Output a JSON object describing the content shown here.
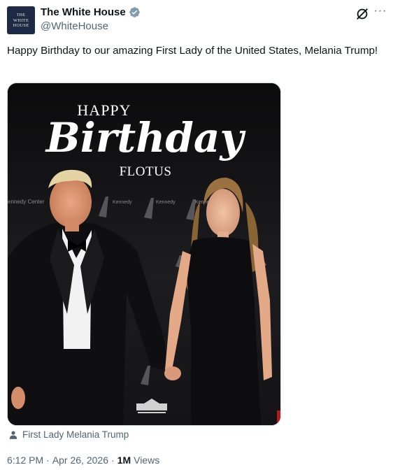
{
  "author": {
    "display_name": "The White House",
    "handle": "@WhiteHouse",
    "avatar_line1": "THE",
    "avatar_line2": "WHITE",
    "avatar_line3": "HOUSE",
    "verified_color": "#829aab"
  },
  "toolbar": {
    "grok_icon": "grok-icon",
    "more_label": "···"
  },
  "tweet": {
    "text": "Happy Birthday to our amazing First Lady of the United States, Melania Trump!"
  },
  "media": {
    "happy": "HAPPY",
    "birthday": "Birthday",
    "flotus": "FLOTUS",
    "backdrop_text_1": "The Kennedy Center",
    "backdrop_text_2": "ennedy Center"
  },
  "tag": {
    "icon": "person-icon",
    "label": "First Lady Melania Trump"
  },
  "meta": {
    "time": "6:12 PM",
    "date": "Apr 26, 2026",
    "views_count": "1M",
    "views_label": "Views",
    "separator": "·"
  },
  "colors": {
    "text_primary": "#0f1419",
    "text_secondary": "#536471",
    "avatar_bg": "#1c2a45"
  }
}
